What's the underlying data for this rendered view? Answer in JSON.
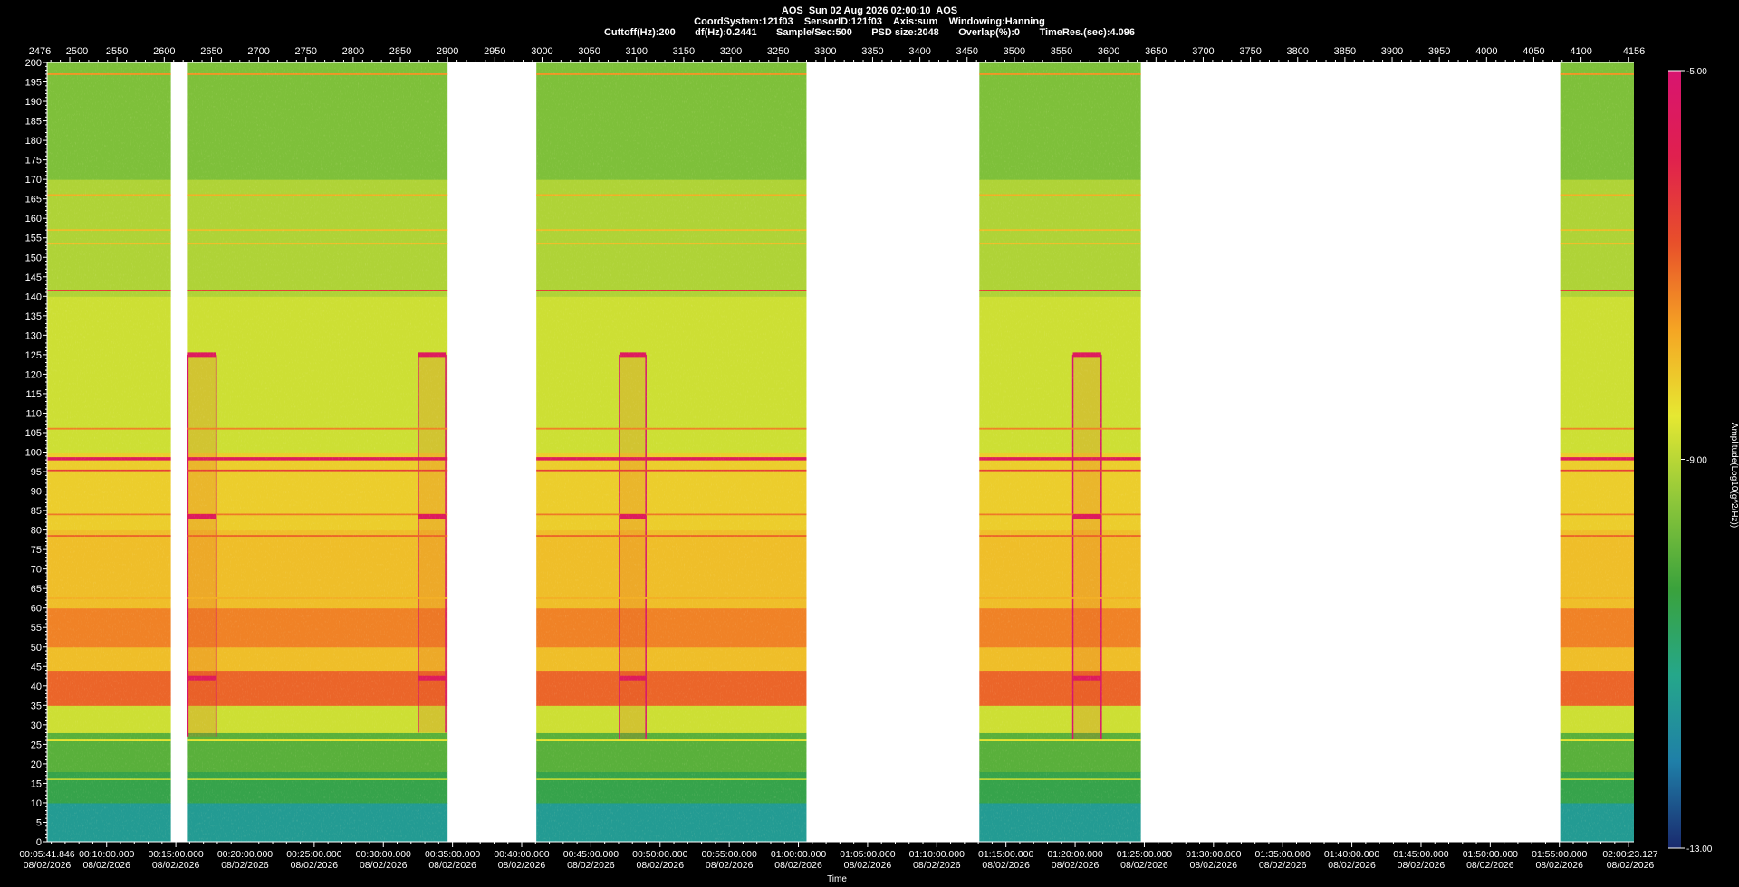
{
  "header": {
    "line1": "AOS  Sun 02 Aug 2026 02:00:10  AOS",
    "line2": "CoordSystem:121f03    SensorID:121f03    Axis:sum    Windowing:Hanning",
    "line3": "Cuttoff(Hz):200       df(Hz):0.2441       Sample/Sec:500       PSD size:2048       Overlap(%):0       TimeRes.(sec):4.096"
  },
  "chart_data": {
    "type": "heatmap",
    "title": "",
    "xlabel": "Time",
    "ylabel": "",
    "colorbar_label": "Amplitude(Log10(g^2/Hz))",
    "ylim": [
      0,
      200
    ],
    "y_ticks": [
      0,
      5,
      10,
      15,
      20,
      25,
      30,
      35,
      40,
      45,
      50,
      55,
      60,
      65,
      70,
      75,
      80,
      85,
      90,
      95,
      100,
      105,
      110,
      115,
      120,
      125,
      130,
      135,
      140,
      145,
      150,
      155,
      160,
      165,
      170,
      175,
      180,
      185,
      190,
      195,
      200
    ],
    "top_axis": {
      "range": [
        2476,
        4156
      ],
      "ticks": [
        2476,
        2500,
        2550,
        2600,
        2650,
        2700,
        2750,
        2800,
        2850,
        2900,
        2950,
        3000,
        3050,
        3100,
        3150,
        3200,
        3250,
        3300,
        3350,
        3400,
        3450,
        3500,
        3550,
        3600,
        3650,
        3700,
        3750,
        3800,
        3850,
        3900,
        3950,
        4000,
        4050,
        4100,
        4156
      ]
    },
    "time_axis": {
      "range": [
        "00:05:41.846",
        "02:00:23.127"
      ],
      "date": "08/02/2026",
      "ticks": [
        "00:05:41.846",
        "00:10:00.000",
        "00:15:00.000",
        "00:20:00.000",
        "00:25:00.000",
        "00:30:00.000",
        "00:35:00.000",
        "00:40:00.000",
        "00:45:00.000",
        "00:50:00.000",
        "00:55:00.000",
        "01:00:00.000",
        "01:05:00.000",
        "01:10:00.000",
        "01:15:00.000",
        "01:20:00.000",
        "01:25:00.000",
        "01:30:00.000",
        "01:35:00.000",
        "01:40:00.000",
        "01:45:00.000",
        "01:50:00.000",
        "01:55:00.000",
        "02:00:23.127"
      ]
    },
    "colorbar": {
      "range": [
        -13.0,
        -5.0
      ],
      "tick_labels": [
        "-5.00",
        "-9.00",
        "-13.00"
      ],
      "tick_values": [
        -5,
        -9,
        -13
      ],
      "colors": [
        "#1a2a6e",
        "#1f7fa8",
        "#25a78a",
        "#3aa23c",
        "#8cc63a",
        "#e6e832",
        "#f5a524",
        "#e8502a",
        "#e0204e",
        "#d81470"
      ]
    },
    "data_segments_index": [
      {
        "start": 2476,
        "end": 2607
      },
      {
        "start": 2625,
        "end": 2900
      },
      {
        "start": 2994,
        "end": 3280
      },
      {
        "start": 3463,
        "end": 3634
      },
      {
        "start": 4078,
        "end": 4156
      }
    ],
    "persistent_lines_hz": [
      {
        "hz": 197,
        "amplitude": -7.5
      },
      {
        "hz": 166,
        "amplitude": -7.8
      },
      {
        "hz": 157,
        "amplitude": -8.0
      },
      {
        "hz": 153.5,
        "amplitude": -8.0
      },
      {
        "hz": 141.5,
        "amplitude": -6.5
      },
      {
        "hz": 106,
        "amplitude": -7.3
      },
      {
        "hz": 98.3,
        "amplitude": -5.5
      },
      {
        "hz": 95.3,
        "amplitude": -6.5
      },
      {
        "hz": 84,
        "amplitude": -7.2
      },
      {
        "hz": 78.5,
        "amplitude": -7.0
      },
      {
        "hz": 62.5,
        "amplitude": -7.8
      },
      {
        "hz": 26,
        "amplitude": -8.5
      },
      {
        "hz": 16,
        "amplitude": -9.0
      }
    ],
    "background_bands_hz": [
      {
        "from": 0,
        "to": 10,
        "amplitude": -11.5
      },
      {
        "from": 10,
        "to": 18,
        "amplitude": -10.5
      },
      {
        "from": 18,
        "to": 28,
        "amplitude": -10.0
      },
      {
        "from": 28,
        "to": 35,
        "amplitude": -8.8
      },
      {
        "from": 35,
        "to": 44,
        "amplitude": -7.0
      },
      {
        "from": 44,
        "to": 50,
        "amplitude": -8.0
      },
      {
        "from": 50,
        "to": 60,
        "amplitude": -7.3
      },
      {
        "from": 60,
        "to": 80,
        "amplitude": -8.0
      },
      {
        "from": 80,
        "to": 100,
        "amplitude": -8.2
      },
      {
        "from": 100,
        "to": 140,
        "amplitude": -8.8
      },
      {
        "from": 140,
        "to": 170,
        "amplitude": -9.1
      },
      {
        "from": 170,
        "to": 200,
        "amplitude": -9.6
      }
    ],
    "events": [
      {
        "start": 2625,
        "end": 2655,
        "from_hz": 27,
        "to_hz": 125,
        "peaks_hz": [
          125,
          83.5,
          42
        ],
        "amplitude": -5.5
      },
      {
        "start": 2869,
        "end": 2898,
        "from_hz": 28,
        "to_hz": 125,
        "peaks_hz": [
          125,
          83.5,
          42
        ],
        "amplitude": -5.5
      },
      {
        "start": 3082,
        "end": 3110,
        "from_hz": 26,
        "to_hz": 125,
        "peaks_hz": [
          125,
          83.5,
          42
        ],
        "amplitude": -5.5
      },
      {
        "start": 3562,
        "end": 3592,
        "from_hz": 26,
        "to_hz": 125,
        "peaks_hz": [
          125,
          83.5,
          42
        ],
        "amplitude": -5.5
      }
    ]
  }
}
